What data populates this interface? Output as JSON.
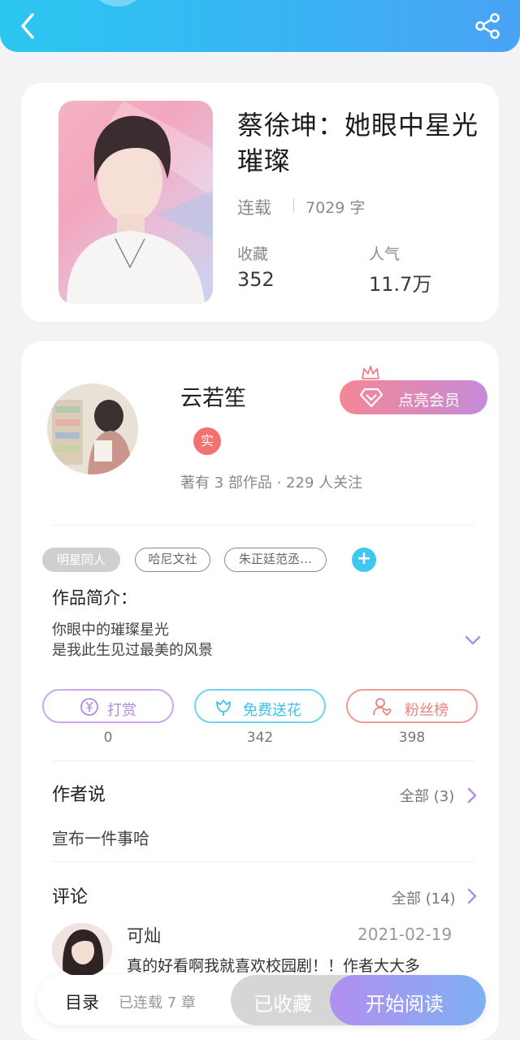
{
  "colors": {
    "accent_blue": "#39b4f3",
    "vip_gradient_start": "#f58796",
    "vip_gradient_end": "#c58bd9",
    "tip_purple": "#b88cec",
    "flower_cyan": "#3fc7f0",
    "fans_red": "#f07a7a"
  },
  "header": {
    "back_icon": "chevron-left-icon",
    "share_icon": "share-icon"
  },
  "book": {
    "title": "蔡徐坤：她眼中星光璀璨",
    "status": "连载",
    "word_count": "7029 字",
    "stats": [
      {
        "label": "收藏",
        "value": "352"
      },
      {
        "label": "人气",
        "value": "11.7万"
      }
    ]
  },
  "author": {
    "name": "云若笙",
    "vip_label": "点亮会员",
    "verified_badge": "实",
    "meta": "著有 3 部作品 · 229 人关注"
  },
  "tags": [
    "明星同人",
    "哈尼文社",
    "朱正廷范丞…"
  ],
  "intro": {
    "heading": "作品简介：",
    "text": "你眼中的璀璨星光\n是我此生见过最美的风景"
  },
  "actions": [
    {
      "label": "打赏",
      "count": "0"
    },
    {
      "label": "免费送花",
      "count": "342"
    },
    {
      "label": "粉丝榜",
      "count": "398"
    }
  ],
  "author_says": {
    "heading": "作者说",
    "more": "全部 (3)",
    "content": "宣布一件事哈"
  },
  "comments": {
    "heading": "评论",
    "more": "全部 (14)",
    "items": [
      {
        "name": "可灿",
        "date": "2021-02-19",
        "text": "真的好看啊我就喜欢校园剧！！作者大大多"
      }
    ]
  },
  "bottom": {
    "toc": "目录",
    "serial": "已连载 7 章",
    "collected": "已收藏",
    "read": "开始阅读"
  }
}
